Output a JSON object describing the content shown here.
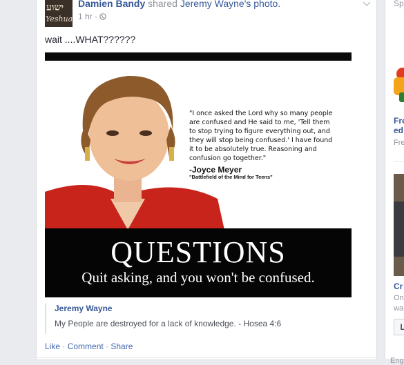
{
  "post": {
    "avatar_text_top": "ישוע",
    "avatar_text_bottom": "Yeshua",
    "author": "Damien Bandy",
    "shared_text": " shared ",
    "original_author": "Jeremy Wayne",
    "photo_text": "'s photo.",
    "time": "1 hr",
    "meta_sep": " · ",
    "privacy_icon": "globe-icon",
    "text": "wait ....WHAT??????",
    "photo": {
      "quote": "\"I once asked the Lord why so many people are confused and He said to me, 'Tell them to stop trying to figure everything out, and they will stop being confused.' I have found it to be absolutely true. Reasoning and confusion go together.\"",
      "author": "-Joyce Meyer",
      "book": "\"Battlefield of the Mind for Teens\"",
      "title": "QUESTIONS",
      "subtitle": "Quit asking, and you won't be confused."
    },
    "shared_author": "Jeremy Wayne",
    "shared_caption": "My People are destroyed for a lack of knowledge. - Hosea 4:6",
    "actions": {
      "like": "Like",
      "comment": "Comment",
      "share": "Share",
      "separator": " · "
    }
  },
  "right_column": {
    "top_text": "Sp",
    "item1_title_line1": "Fre",
    "item1_title_line2": "ed",
    "item1_sub": "Fre",
    "item2_title": "Cr",
    "item2_sub_line1": "On",
    "item2_sub_line2": "wa",
    "button_label": "L",
    "bottom_text": "Eng"
  }
}
